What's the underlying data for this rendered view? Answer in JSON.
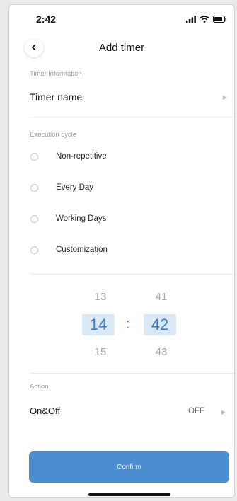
{
  "status": {
    "time": "2:42"
  },
  "header": {
    "title": "Add timer"
  },
  "timer_info": {
    "section_label": "Timer information",
    "name_label": "Timer name"
  },
  "cycle": {
    "section_label": "Execution cycle",
    "options": [
      "Non-repetitive",
      "Every Day",
      "Working Days",
      "Customization"
    ]
  },
  "time_picker": {
    "hours_prev": "13",
    "hours_selected": "14",
    "hours_next": "15",
    "minutes_prev": "41",
    "minutes_selected": "42",
    "minutes_next": "43",
    "separator": ":"
  },
  "action": {
    "section_label": "Action",
    "label": "On&Off",
    "value": "OFF"
  },
  "footer": {
    "confirm_label": "Confirm"
  }
}
